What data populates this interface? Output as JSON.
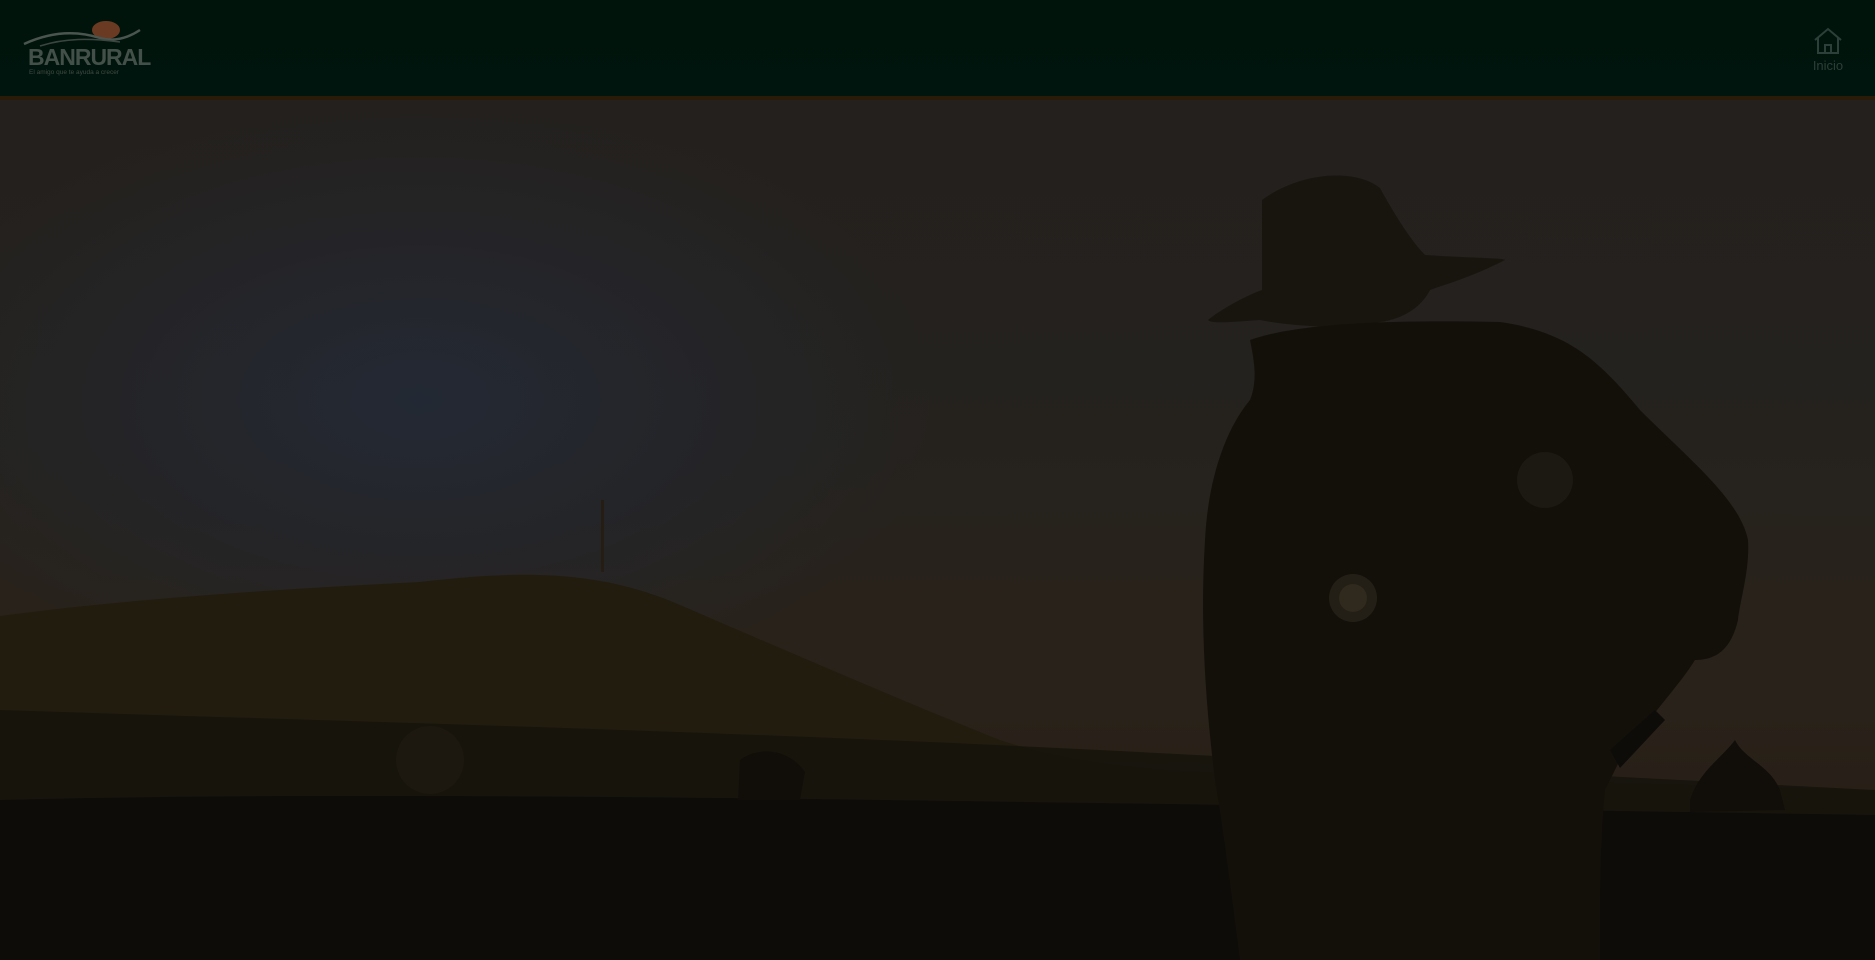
{
  "header": {
    "logo": {
      "brand": "BANRURAL",
      "slogan": "El amigo que te ayuda a crecer"
    },
    "nav": {
      "home_label": "Inicio",
      "home_icon": "home-icon"
    }
  },
  "hero": {
    "image": "silhouette-farmer-with-hat-hill-landscape"
  },
  "colors": {
    "header_bg": "#00140c",
    "header_border": "#2a1a08",
    "logo_sun": "#6b3a22",
    "logo_text": "#43504a",
    "home_icon": "#2c3f38"
  }
}
